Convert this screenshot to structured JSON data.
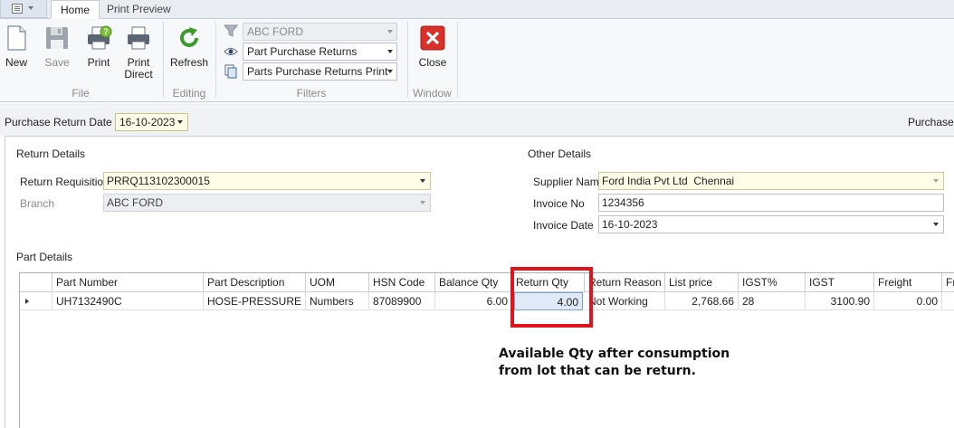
{
  "tabs": [
    {
      "label": "Home",
      "active": true
    },
    {
      "label": "Print Preview",
      "active": false
    }
  ],
  "ribbon": {
    "groups": {
      "file": "File",
      "editing": "Editing",
      "filters": "Filters",
      "window": "Window"
    },
    "buttons": {
      "new": "New",
      "save": "Save",
      "print": "Print",
      "print_direct": "Print\nDirect",
      "refresh": "Refresh",
      "close": "Close"
    },
    "filters": {
      "branch": "ABC FORD",
      "view": "Part Purchase Returns",
      "report": "Parts Purchase Returns Print"
    },
    "colors": {
      "refresh_green": "#3a9a2c",
      "close_red": "#d9302a"
    }
  },
  "header": {
    "purchase_return_date_label": "Purchase Return Date",
    "purchase_return_date": "16-10-2023",
    "right_label": "Purchase R"
  },
  "return_details": {
    "title": "Return Details",
    "requisition_label": "Return Requisition",
    "requisition_value": "PRRQ113102300015",
    "branch_label": "Branch",
    "branch_value": "ABC FORD"
  },
  "other_details": {
    "title": "Other Details",
    "supplier_label": "Supplier Name",
    "supplier_value": "Ford India Pvt Ltd  Chennai",
    "invoice_no_label": "Invoice No",
    "invoice_no_value": "1234356",
    "invoice_date_label": "Invoice Date",
    "invoice_date_value": "16-10-2023"
  },
  "part_details": {
    "title": "Part Details",
    "columns": [
      "Part Number",
      "Part Description",
      "UOM",
      "HSN Code",
      "Balance Qty",
      "Return Qty",
      "Return Reason",
      "List price",
      "IGST%",
      "IGST",
      "Freight",
      "Fr"
    ],
    "rows": [
      [
        "UH7132490C",
        "HOSE-PRESSURE",
        "Numbers",
        "87089900",
        "6.00",
        "4.00",
        "Not Working",
        "2,768.66",
        "28",
        "3100.90",
        "0.00",
        ""
      ]
    ]
  },
  "annotation": {
    "line1": "Available Qty after consumption",
    "line2": "from lot that can be return.",
    "highlight_color": "#e0141c"
  }
}
